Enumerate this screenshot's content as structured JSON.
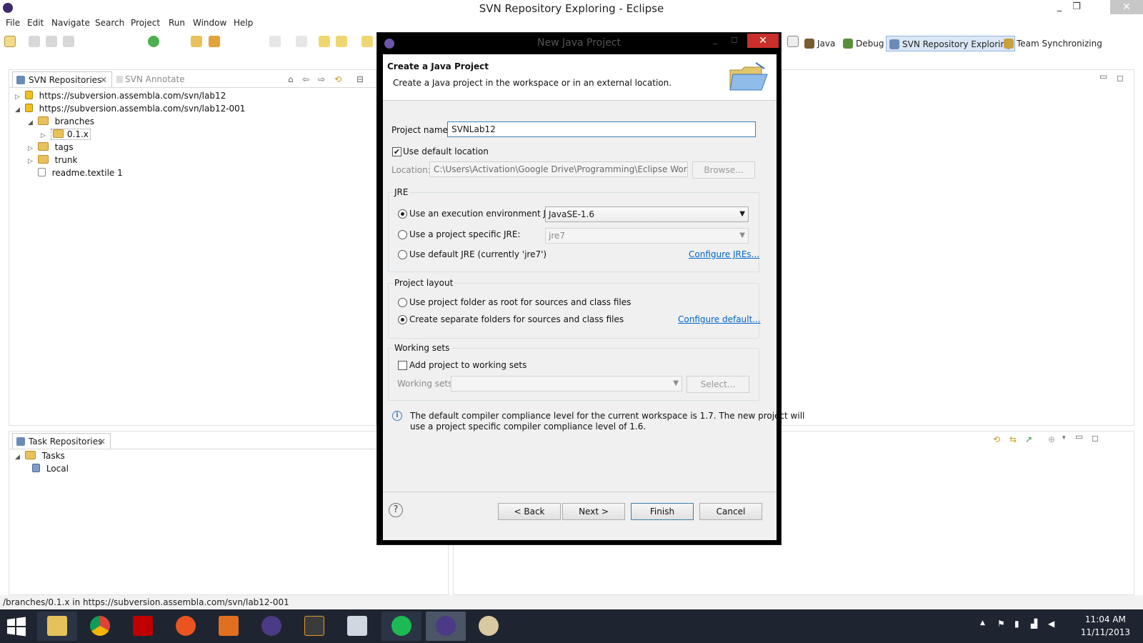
{
  "window": {
    "title": "SVN Repository Exploring - Eclipse",
    "minimize": "_",
    "restore": "❐",
    "close": "✕"
  },
  "menu": [
    "File",
    "Edit",
    "Navigate",
    "Search",
    "Project",
    "Run",
    "Window",
    "Help"
  ],
  "perspectives": [
    "Java",
    "Debug",
    "SVN Repository Exploring",
    "Team Synchronizing"
  ],
  "svn_view": {
    "tab_label": "SVN Repositories",
    "annotate_label": "SVN Annotate",
    "tree": [
      {
        "label": "https://subversion.assembla.com/svn/lab12",
        "twisty": "▷"
      },
      {
        "label": "https://subversion.assembla.com/svn/lab12-001",
        "twisty": "◢"
      },
      {
        "label": "branches",
        "twisty": "◢"
      },
      {
        "label": "0.1.x",
        "twisty": "▷"
      },
      {
        "label": "tags",
        "twisty": "▷"
      },
      {
        "label": "trunk",
        "twisty": "▷"
      },
      {
        "label": "readme.textile 1",
        "twisty": ""
      }
    ]
  },
  "task_view": {
    "tab_label": "Task Repositories",
    "tree": [
      {
        "label": "Tasks",
        "twisty": "◢"
      },
      {
        "label": "Local",
        "twisty": ""
      }
    ]
  },
  "status_text": "/branches/0.1.x in https://subversion.assembla.com/svn/lab12-001",
  "dialog": {
    "window_title": "New Java Project",
    "heading": "Create a Java Project",
    "description": "Create a Java project in the workspace or in an external location.",
    "project_name_label": "Project name:",
    "project_name_value": "SVNLab12",
    "use_default_location_label": "Use default location",
    "use_default_location_checked": "✔",
    "location_label": "Location:",
    "location_value": "C:\\Users\\Activation\\Google Drive\\Programming\\Eclipse Workspace\\",
    "browse_label": "Browse...",
    "jre": {
      "group_label": "JRE",
      "opt_exec_env": "Use an execution environment JRE:",
      "exec_env_value": "JavaSE-1.6",
      "opt_project_specific": "Use a project specific JRE:",
      "project_specific_value": "jre7",
      "opt_default": "Use default JRE (currently 'jre7')",
      "configure_link": "Configure JREs..."
    },
    "layout": {
      "group_label": "Project layout",
      "opt_root": "Use project folder as root for sources and class files",
      "opt_separate": "Create separate folders for sources and class files",
      "configure_link": "Configure default..."
    },
    "working_sets": {
      "group_label": "Working sets",
      "add_label": "Add project to working sets",
      "sets_label": "Working sets:",
      "select_label": "Select..."
    },
    "info_text_1": "The default compiler compliance level for the current workspace is 1.7. The new project will",
    "info_text_2": "use a project specific compiler compliance level of 1.6.",
    "buttons": {
      "help": "?",
      "back": "< Back",
      "next": "Next >",
      "finish": "Finish",
      "cancel": "Cancel"
    }
  },
  "taskbar": {
    "time": "11:04 AM",
    "date": "11/11/2013"
  }
}
